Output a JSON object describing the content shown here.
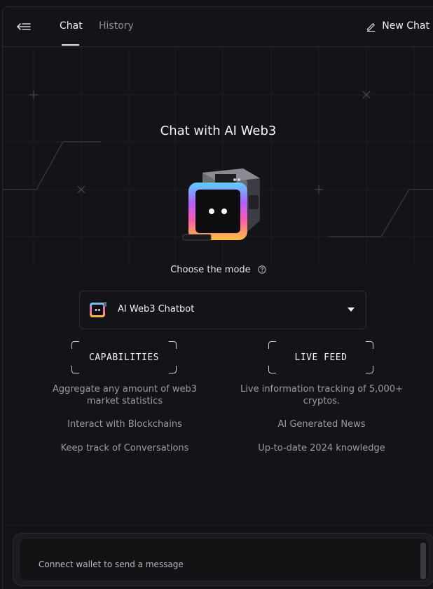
{
  "header": {
    "tabs": [
      {
        "label": "Chat",
        "active": true
      },
      {
        "label": "History",
        "active": false
      }
    ],
    "new_chat_label": "New Chat"
  },
  "hero": {
    "title": "Chat with AI Web3"
  },
  "mode": {
    "label": "Choose the mode",
    "selected": "AI Web3 Chatbot"
  },
  "capabilities": {
    "title": "CAPABILITIES",
    "items": [
      "Aggregate any amount of web3 market statistics",
      "Interact with Blockchains",
      "Keep track of Conversations"
    ]
  },
  "live_feed": {
    "title": "LIVE FEED",
    "items": [
      "Live information tracking of 5,000+ cryptos.",
      "AI Generated News",
      "Up-to-date 2024 knowledge"
    ]
  },
  "composer": {
    "placeholder": "Connect wallet to send a message"
  },
  "colors": {
    "background": "#141418",
    "border": "#2a2a30",
    "text_primary": "#f2f2f2",
    "text_muted": "#9a9aa1"
  },
  "icons": {
    "menu": "collapse-menu-icon",
    "new_chat": "pencil-icon",
    "help": "question-circle-icon",
    "dropdown": "caret-down-icon",
    "bot": "robot-icon"
  }
}
